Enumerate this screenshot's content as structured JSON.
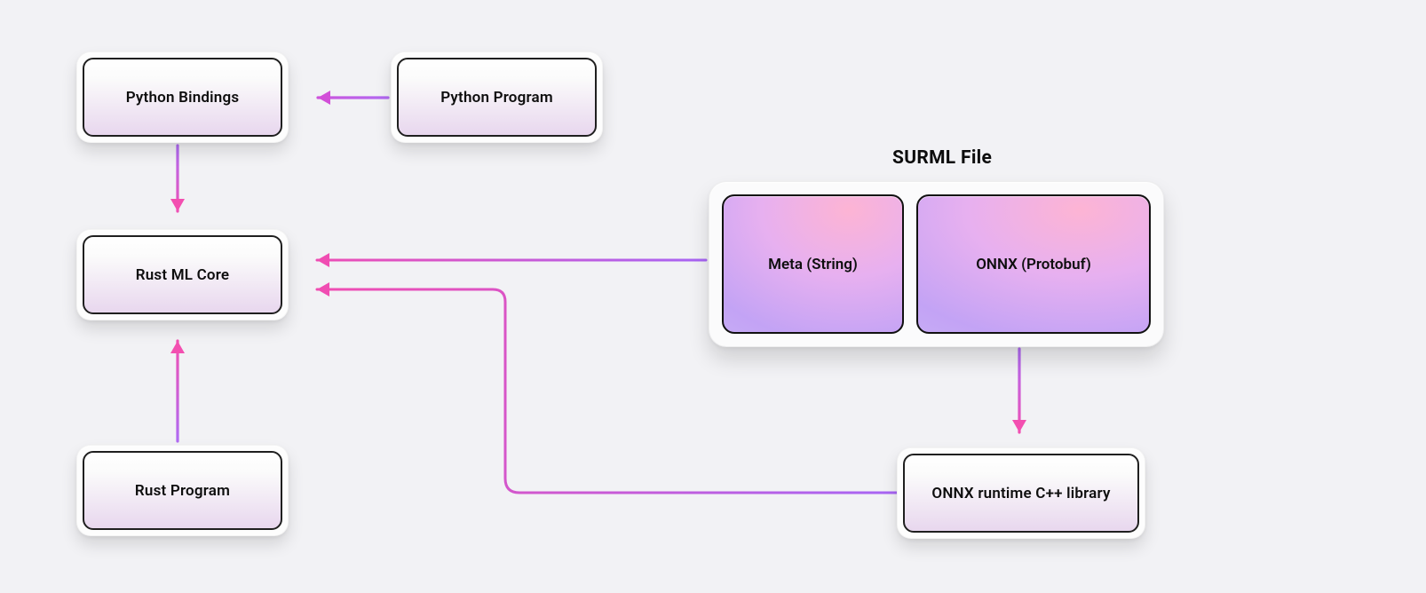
{
  "diagram": {
    "title": "SURML File",
    "nodes": {
      "python_bindings": "Python Bindings",
      "python_program": "Python Program",
      "rust_ml_core": "Rust ML Core",
      "rust_program": "Rust Program",
      "onnx_runtime": "ONNX runtime C++ library",
      "surml_meta": "Meta (String)",
      "surml_onnx": "ONNX (Protobuf)"
    },
    "edges": [
      {
        "from": "python_program",
        "to": "python_bindings"
      },
      {
        "from": "python_bindings",
        "to": "rust_ml_core"
      },
      {
        "from": "rust_program",
        "to": "rust_ml_core"
      },
      {
        "from": "surml_file",
        "to": "rust_ml_core"
      },
      {
        "from": "onnx_runtime",
        "to": "rust_ml_core"
      },
      {
        "from": "surml_onnx",
        "to": "onnx_runtime"
      }
    ]
  }
}
